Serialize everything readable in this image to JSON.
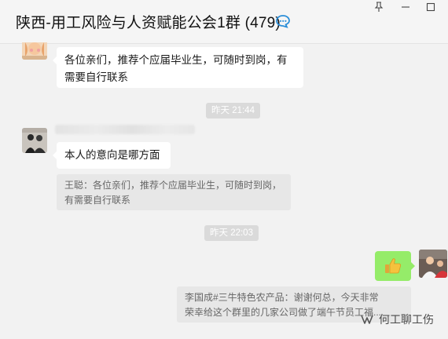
{
  "window": {
    "title": "陕西-用工风险与人资赋能公会1群 (479)",
    "pin_icon": "pin-icon",
    "minimize_icon": "minimize-icon",
    "maximize_icon": "maximize-icon"
  },
  "messages": [
    {
      "type": "text",
      "side": "left",
      "lines": [
        "各位亲们，推荐个应届毕业生，可随时到岗，有",
        "需要自行联系"
      ]
    },
    {
      "type": "time",
      "text": "昨天 21:44"
    },
    {
      "type": "text",
      "side": "left",
      "lines": [
        "本人的意向是哪方面"
      ]
    },
    {
      "type": "quote",
      "lines": [
        "王聪：各位亲们，推荐个应届毕业生，可随时到岗，",
        "有需要自行联系"
      ]
    },
    {
      "type": "time",
      "text": "昨天 22:03"
    },
    {
      "type": "emoji",
      "side": "right",
      "icon": "thumbs-up-icon"
    },
    {
      "type": "quote",
      "lines": [
        "李国成#三牛特色农产品：谢谢何总，今天非常",
        "荣幸给这个群里的几家公司做了端午节员工福..."
      ]
    }
  ],
  "watermark": {
    "text": "何工聊工伤",
    "icon": "wechat-channel-icon"
  },
  "colors": {
    "self_bubble": "#95ec69",
    "background": "#f2f2f2",
    "bubble": "#ffffff",
    "quote_bg": "#e7e7e7"
  }
}
